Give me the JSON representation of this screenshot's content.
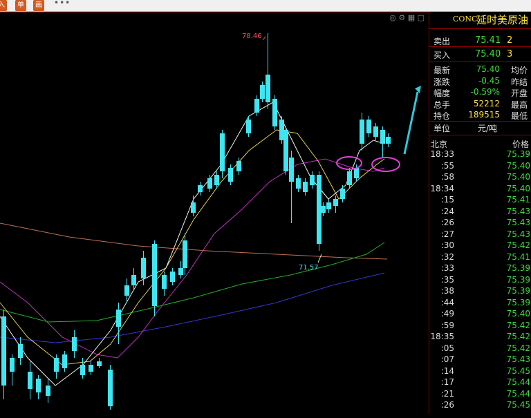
{
  "toolbar": {
    "btn1": "入",
    "btn2": "单",
    "btn3": "画",
    "more": "•••"
  },
  "chart": {
    "high_label": "78.46",
    "low_label": "71.57",
    "colors": {
      "up": "#ff3b3b",
      "down": "#3ee6f2",
      "ma5": "#f2f2f2",
      "ma10": "#e6d24a",
      "ma20": "#c030c0",
      "ma60": "#22b022",
      "ma120": "#3636d0",
      "ma250": "#c07050",
      "annotation": "#e040e0",
      "arrow": "#2ec9d8"
    }
  },
  "panel": {
    "code": "CONC",
    "name": "延时美原油",
    "sell_label": "卖出",
    "sell_price": "75.41",
    "sell_qty": "2",
    "buy_label": "买入",
    "buy_price": "75.40",
    "buy_qty": "3",
    "stats": [
      {
        "label": "最新",
        "value": "75.40",
        "label2": "均价"
      },
      {
        "label": "涨跌",
        "value": "-0.45",
        "label2": "昨结"
      },
      {
        "label": "幅度",
        "value": "-0.59%",
        "label2": "开盘"
      },
      {
        "label": "总手",
        "value": "52212",
        "label2": "最高"
      },
      {
        "label": "持仓",
        "value": "189515",
        "label2": "最低"
      }
    ],
    "unit_label": "单位",
    "unit_value": "元/吨",
    "ticks_header_left": "北京",
    "ticks_header_right": "价格",
    "ticks": [
      {
        "time": "18:33",
        "price": "75.39"
      },
      {
        "time": ":55",
        "price": "75.40"
      },
      {
        "time": ":58",
        "price": "75.40"
      },
      {
        "time": "18:34",
        "price": "75.40"
      },
      {
        "time": ":15",
        "price": "75.41"
      },
      {
        "time": ":24",
        "price": "75.43"
      },
      {
        "time": ":26",
        "price": "75.43"
      },
      {
        "time": ":27",
        "price": "75.43"
      },
      {
        "time": ":30",
        "price": "75.42"
      },
      {
        "time": ":32",
        "price": "75.41"
      },
      {
        "time": ":33",
        "price": "75.39"
      },
      {
        "time": ":35",
        "price": "75.39"
      },
      {
        "time": ":38",
        "price": "75.39"
      },
      {
        "time": ":44",
        "price": "75.39"
      },
      {
        "time": ":49",
        "price": "75.40"
      },
      {
        "time": ":59",
        "price": "75.42"
      },
      {
        "time": "18:35",
        "price": "75.42"
      },
      {
        "time": ":05",
        "price": "75.42"
      },
      {
        "time": ":07",
        "price": "75.43"
      },
      {
        "time": ":14",
        "price": "75.45"
      },
      {
        "time": ":17",
        "price": "75.44"
      },
      {
        "time": ":21",
        "price": "75.44"
      },
      {
        "time": ":26",
        "price": "75.45"
      }
    ]
  }
}
